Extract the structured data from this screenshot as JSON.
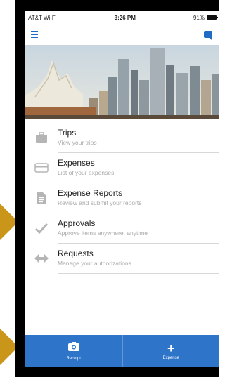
{
  "status_bar": {
    "carrier": "AT&T Wi-Fi",
    "time": "3:26 PM",
    "battery": "91%"
  },
  "header": {
    "menu_icon": "hamburger-icon",
    "chat_icon": "chat-bubble-icon"
  },
  "menu": {
    "items": [
      {
        "title": "Trips",
        "subtitle": "View your trips",
        "icon": "briefcase-icon"
      },
      {
        "title": "Expenses",
        "subtitle": "List of your expenses",
        "icon": "credit-card-icon"
      },
      {
        "title": "Expense Reports",
        "subtitle": "Review and submit your reports",
        "icon": "document-icon"
      },
      {
        "title": "Approvals",
        "subtitle": "Approve items anywhere, anytime",
        "icon": "checkmark-icon"
      },
      {
        "title": "Requests",
        "subtitle": "Manage your authorizations",
        "icon": "arrows-icon"
      }
    ]
  },
  "bottom_bar": {
    "receipt_label": "Receipt",
    "expense_label": "Expense"
  },
  "colors": {
    "accent": "#2e75c9",
    "pointer": "#c9961a",
    "icon_gray": "#b5b5b5"
  }
}
